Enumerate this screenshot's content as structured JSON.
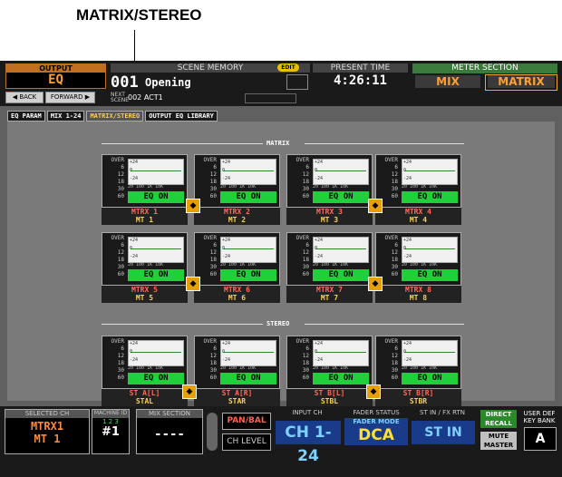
{
  "callout": "MATRIX/STEREO",
  "output": {
    "label": "OUTPUT",
    "value": "EQ",
    "back": "◀ BACK",
    "forward": "FORWARD ▶"
  },
  "scene": {
    "header": "SCENE MEMORY",
    "edit": "EDIT",
    "number": "001",
    "title": "Opening",
    "next_label": "NEXT SCENE",
    "next_value": "002 ACT1"
  },
  "time": {
    "header": "PRESENT TIME",
    "value": "4:26:11"
  },
  "meter_section": {
    "header": "METER SECTION",
    "mix": "MIX",
    "matrix": "MATRIX"
  },
  "tabs": [
    {
      "label": "EQ PARAM"
    },
    {
      "label": "MIX 1-24"
    },
    {
      "label": "MATRIX/STEREO"
    },
    {
      "label": "OUTPUT EQ LIBRARY"
    }
  ],
  "sections": {
    "matrix": "MATRIX",
    "stereo": "STEREO"
  },
  "meter_scale": [
    "OVER",
    "6",
    "12",
    "18",
    "30",
    "60"
  ],
  "graph_ticks": [
    "+24",
    "0",
    "-24"
  ],
  "freq_labels": "20 100 1K 10K",
  "eq_status": "EQ ON",
  "matrix_cards": [
    {
      "name1": "MTRX 1",
      "name2": "MT 1"
    },
    {
      "name1": "MTRX 2",
      "name2": "MT 2"
    },
    {
      "name1": "MTRX 3",
      "name2": "MT 3"
    },
    {
      "name1": "MTRX 4",
      "name2": "MT 4"
    },
    {
      "name1": "MTRX 5",
      "name2": "MT 5"
    },
    {
      "name1": "MTRX 6",
      "name2": "MT 6"
    },
    {
      "name1": "MTRX 7",
      "name2": "MT 7"
    },
    {
      "name1": "MTRX 8",
      "name2": "MT 8"
    }
  ],
  "stereo_cards": [
    {
      "name1": "ST A[L]",
      "name2": "STAL"
    },
    {
      "name1": "ST A[R]",
      "name2": "STAR"
    },
    {
      "name1": "ST B[L]",
      "name2": "STBL"
    },
    {
      "name1": "ST B[R]",
      "name2": "STBR"
    }
  ],
  "footer": {
    "selected_ch_label": "SELECTED CH",
    "selected_ch_1": "MTRX1",
    "selected_ch_2": "MT 1",
    "machine_id_label": "MACHINE ID",
    "machine_id_nums": "1 2 3",
    "machine_id_val": "#1",
    "mix_section_label": "MIX SECTION",
    "mix_section_val": "----",
    "pan_bal": "PAN/BAL",
    "ch_level": "CH LEVEL",
    "input_ch_label": "INPUT CH",
    "input_ch_val": "CH 1-24",
    "fader_status_label": "FADER STATUS",
    "fader_mode": "FADER MODE",
    "fader_val": "DCA",
    "st_in_label": "ST IN / FX RTN",
    "st_in_val": "ST IN",
    "direct_recall": "DIRECT RECALL",
    "user_def_label": "USER DEF KEY BANK",
    "mute_master": "MUTE MASTER",
    "key_bank": "A"
  }
}
